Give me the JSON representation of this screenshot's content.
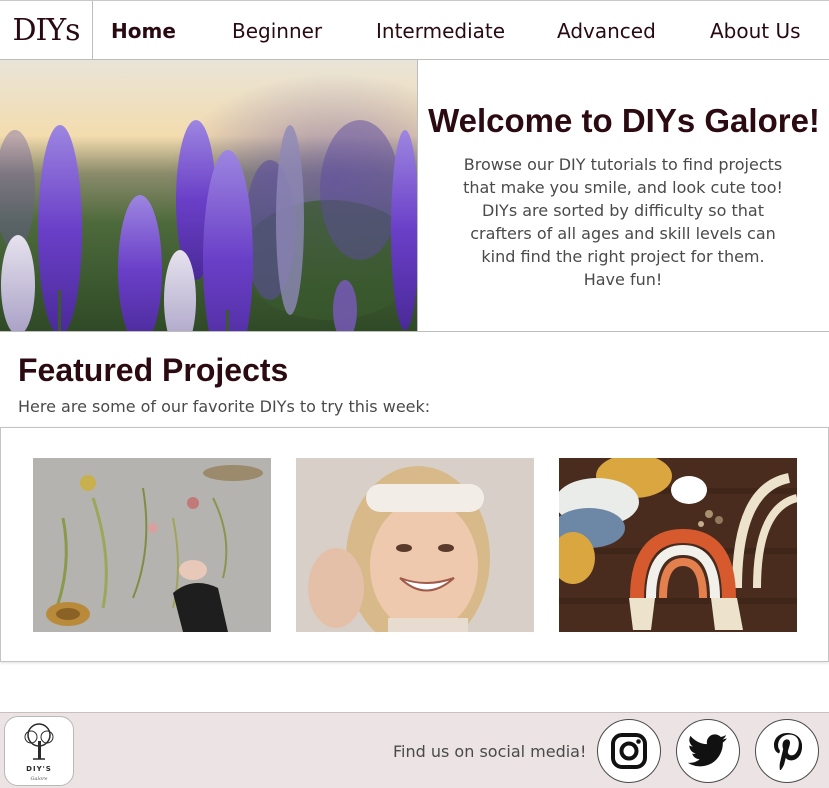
{
  "nav": {
    "brand": "DIYs",
    "links": [
      {
        "label": "Home",
        "active": true
      },
      {
        "label": "Beginner"
      },
      {
        "label": "Intermediate"
      },
      {
        "label": "Advanced"
      },
      {
        "label": "About Us"
      }
    ]
  },
  "hero": {
    "image_icon": "lupine-flowers-photo",
    "title": "Welcome to DIYs Galore!",
    "body": "Browse our DIY tutorials to find projects that make you smile, and look cute too! DIYs are sorted by difficulty so that crafters of all ages and skill levels can kind find the right project for them. Have fun!"
  },
  "featured": {
    "title": "Featured Projects",
    "subtitle": "Here are some of our favorite DIYs to try this week:",
    "cards": [
      {
        "icon": "pressed-flowers-photo"
      },
      {
        "icon": "smiling-woman-headband-photo"
      },
      {
        "icon": "yarn-macrame-rainbow-photo"
      }
    ]
  },
  "footer": {
    "logo_name": "DIY'S",
    "logo_sub": "Galore",
    "social_text": "Find us on social media!",
    "social_icons": [
      "instagram-icon",
      "twitter-icon",
      "pinterest-icon"
    ]
  },
  "colors": {
    "accent_dark": "#2b0a12",
    "footer_bg": "#ece3e5",
    "body_text": "#4a4a4a"
  }
}
